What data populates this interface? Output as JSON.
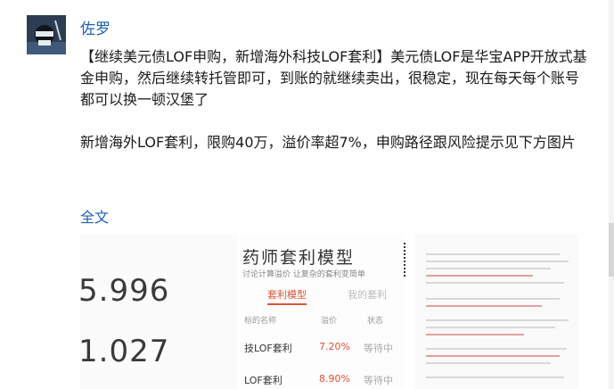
{
  "post": {
    "author": "佐罗",
    "paragraph1": "【继续美元债LOF申购，新增海外科技LOF套利】美元债LOF是华宝APP开放式基金申购，然后继续转托管即可，到账的就继续卖出，很稳定，现在每天每个账号都可以换一顿汉堡了",
    "paragraph2": "新增海外LOF套利，限购40万，溢价率超7%，申购路径跟风险提示见下方图片",
    "full_text_link": "全文"
  },
  "images": {
    "image1": {
      "value1": "5.996",
      "value2": "1.027"
    },
    "image2": {
      "title": "药师套利模型",
      "subtitle": "讨论计算溢价 让复杂的套利变简单",
      "tab_active": "套利模型",
      "tab_inactive": "我的套利",
      "headers": [
        "标的名称",
        "溢价",
        "状态"
      ],
      "rows": [
        {
          "name": "技LOF套利",
          "premium": "7.20%",
          "status": "等待中"
        },
        {
          "name": "LOF套利",
          "premium": "8.90%",
          "status": "等待中"
        }
      ]
    }
  },
  "colors": {
    "link": "#1f5fb4",
    "accent": "#e0533a"
  }
}
